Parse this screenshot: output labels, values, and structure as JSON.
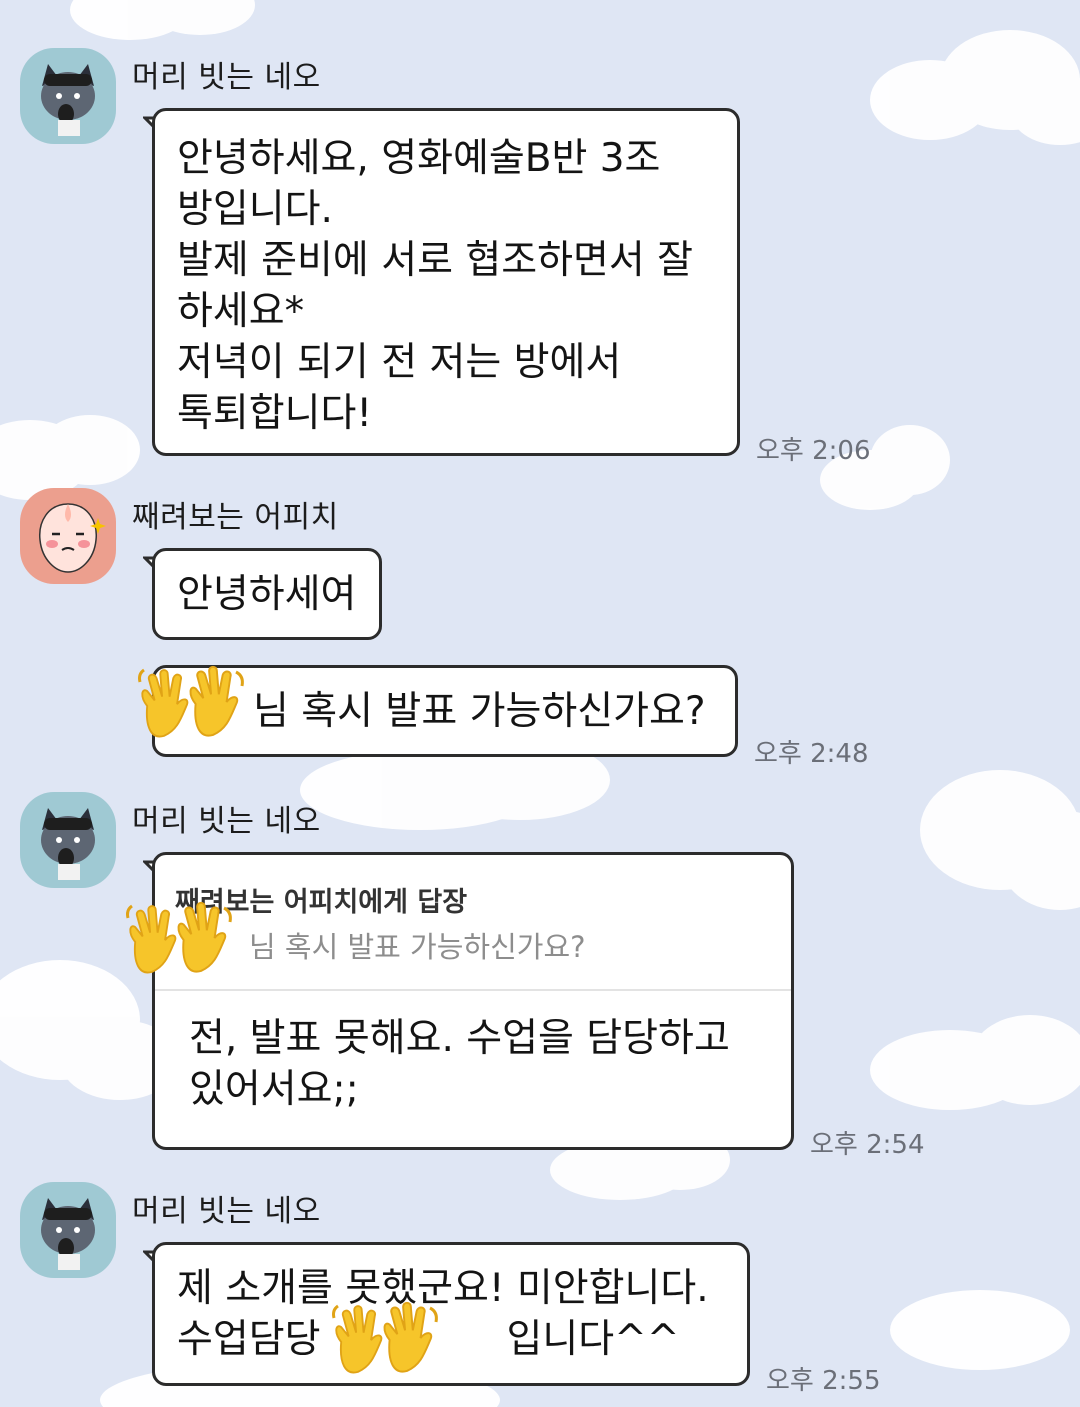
{
  "chat": {
    "messages": [
      {
        "sender": "머리 빗는 네오",
        "avatar_icon": "neo-avatar-icon",
        "lines": [
          "안녕하세요, 영화예술B반 3조",
          "방입니다.",
          "발제 준비에 서로 협조하면서 잘",
          "하세요*",
          "저녁이 되기 전 저는 방에서",
          "톡퇴합니다!"
        ],
        "time": "오후 2:06"
      },
      {
        "sender": "째려보는 어피치",
        "avatar_icon": "apeach-avatar-icon",
        "lines": [
          "안녕하세여"
        ]
      },
      {
        "lines": [
          "님 혹시 발표 가능하신가요?"
        ],
        "time": "오후 2:48"
      },
      {
        "sender": "머리 빗는 네오",
        "avatar_icon": "neo-avatar-icon",
        "reply_to": "째려보는 어피치에게 답장",
        "reply_quote": "님 혹시 발표 가능하신가요?",
        "lines": [
          "전, 발표 못해요. 수업을 담당하고",
          "있어서요;;"
        ],
        "time": "오후 2:54"
      },
      {
        "sender": "머리 빗는 네오",
        "avatar_icon": "neo-avatar-icon",
        "lines": [
          "제 소개를 못했군요! 미안합니다.",
          "수업담당",
          "입니다^^"
        ],
        "time": "오후 2:55"
      }
    ]
  },
  "colors": {
    "background": "#dfe6f4",
    "bubble": "#ffffff",
    "bubble_border": "#2c2c2c",
    "neo_avatar_bg": "#9fc9d3",
    "apeach_avatar_bg": "#ec9f8e",
    "emoji_yellow": "#f6c52a"
  },
  "icons": [
    "neo-avatar-icon",
    "apeach-avatar-icon",
    "clapping-hands-emoji-icon"
  ]
}
